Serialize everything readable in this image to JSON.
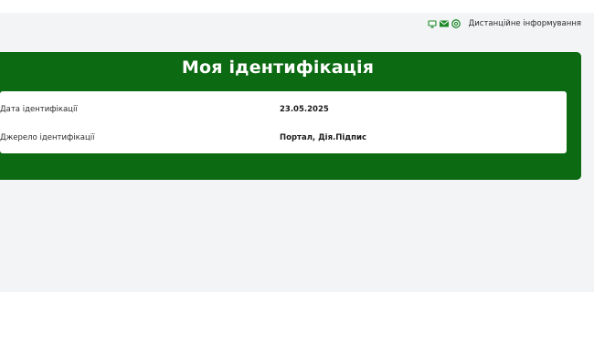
{
  "utility_bar": {
    "icons": [
      "monitor-icon",
      "mail-icon",
      "at-icon"
    ],
    "remote_info_label": "Дистанційне інформування"
  },
  "identification": {
    "title": "Моя ідентифікація",
    "rows": [
      {
        "label": "Дата ідентифікації",
        "value": "23.05.2025"
      },
      {
        "label": "Джерело ідентифікації",
        "value": "Портал, Дія.Підпис"
      }
    ]
  },
  "colors": {
    "brand_green": "#0c6a12",
    "page_background": "#f3f4f6",
    "panel_background": "#ffffff"
  }
}
